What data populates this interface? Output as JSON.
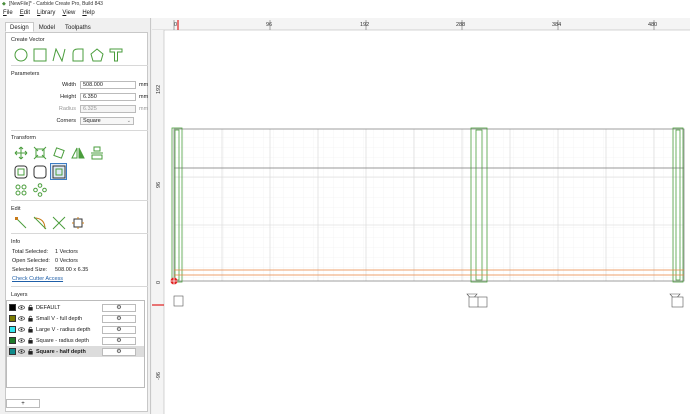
{
  "window": {
    "title": "[NewFile]* - Carbide Create Pro, Build 843"
  },
  "menu": {
    "items": [
      "File",
      "Edit",
      "Library",
      "View",
      "Help"
    ]
  },
  "tabs": {
    "design": "Design",
    "model": "Model",
    "toolpaths": "Toolpaths"
  },
  "sections": {
    "create_vector": "Create Vector",
    "parameters": "Parameters",
    "transform": "Transform",
    "edit": "Edit",
    "info": "Info",
    "layers": "Layers"
  },
  "create_vector_icons": [
    "circle-icon",
    "rectangle-icon",
    "polyline-icon",
    "curve-icon",
    "polygon-icon",
    "text-icon"
  ],
  "parameters": {
    "width_label": "Width",
    "width_value": "508.000",
    "width_unit": "mm",
    "height_label": "Height",
    "height_value": "6.350",
    "height_unit": "mm",
    "radius_label": "Radius",
    "radius_value": "6.325",
    "radius_unit": "mm",
    "corners_label": "Corners",
    "corners_value": "Square"
  },
  "transform_icons": [
    "move-icon",
    "scale-icon",
    "rotate-icon",
    "mirror-icon",
    "align-icon",
    "offset-icon",
    "boolean-icon",
    "inset-icon",
    "array-icon",
    "circular-array-icon"
  ],
  "edit_icons": [
    "node-edit-icon",
    "fillet-icon",
    "trim-icon",
    "join-icon"
  ],
  "info": {
    "total_selected_label": "Total Selected:",
    "total_selected_value": "1 Vectors",
    "open_selected_label": "Open Selected:",
    "open_selected_value": "0 Vectors",
    "selected_size_label": "Selected Size:",
    "selected_size_value": "508.00 x 6.35",
    "check_cutter": "Check Cutter Access"
  },
  "layers": [
    {
      "name": "DEFAULT",
      "color": "#000000"
    },
    {
      "name": "Small V - full depth",
      "color": "#7a7a00"
    },
    {
      "name": "Large V - radius depth",
      "color": "#33e6f0"
    },
    {
      "name": "Square - radius depth",
      "color": "#1e7a2a"
    },
    {
      "name": "Square - half depth",
      "color": "#0f8a8a",
      "selected": true
    }
  ],
  "add_layer": "+",
  "ruler": {
    "top_labels": [
      "0",
      "96",
      "192",
      "288",
      "384",
      "480"
    ],
    "left_labels": [
      "192",
      "96",
      "0",
      "-96"
    ]
  },
  "colors": {
    "accent": "#4a9d3c",
    "selection": "#3c7dc4",
    "ruler_marker": "#e02020",
    "orange_vector": "#e8823c"
  }
}
